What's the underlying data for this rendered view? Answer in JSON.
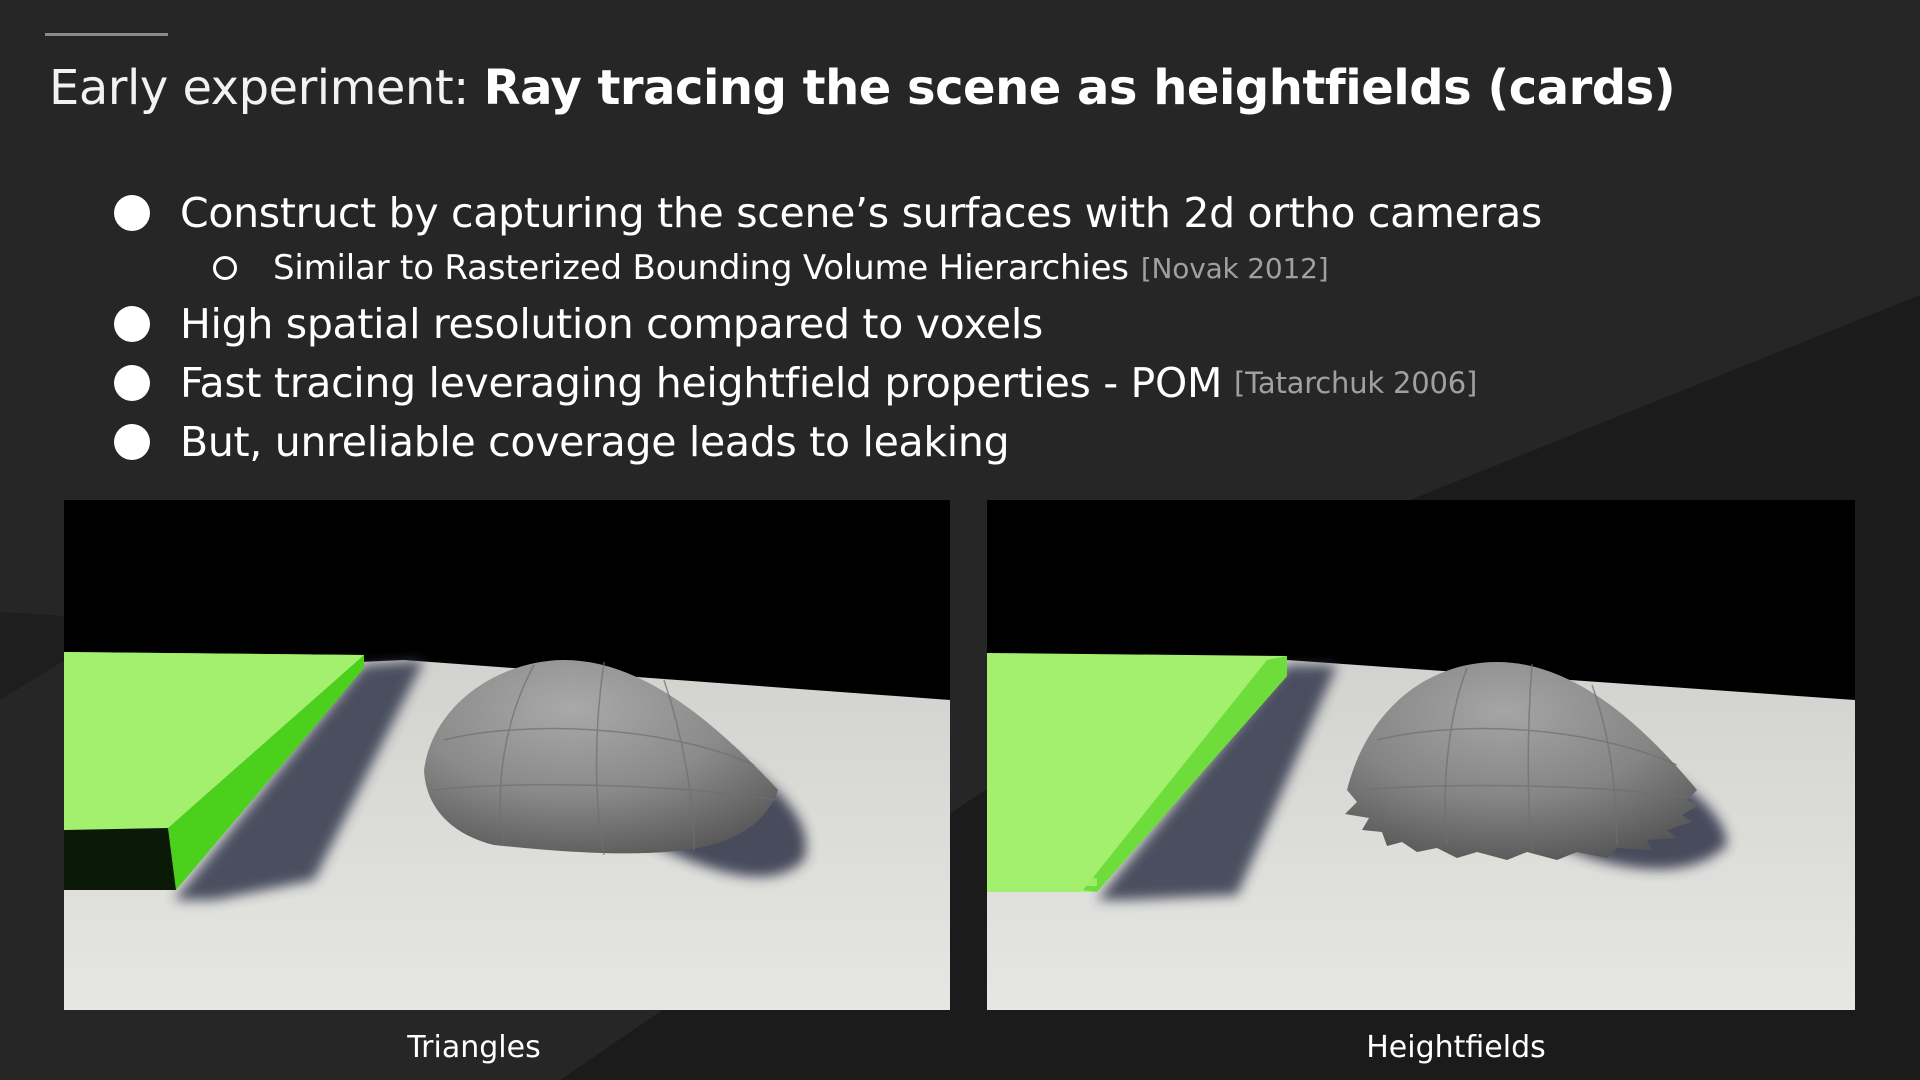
{
  "title": {
    "prefix": "Early experiment: ",
    "emphasis": "Ray tracing the scene as heightfields (cards)"
  },
  "bullets": [
    {
      "text": "Construct by capturing the scene’s surfaces with 2d ortho cameras",
      "cite": ""
    },
    {
      "text": "High spatial resolution compared to voxels",
      "cite": ""
    },
    {
      "text": "Fast tracing leveraging heightfield properties - POM",
      "cite": "[Tatarchuk 2006]"
    },
    {
      "text": "But, unreliable coverage leads to leaking",
      "cite": ""
    }
  ],
  "subbullet": {
    "text": "Similar to Rasterized Bounding Volume Hierarchies",
    "cite": "[Novak 2012]"
  },
  "figures": [
    {
      "caption": "Triangles"
    },
    {
      "caption": "Heightfields"
    }
  ],
  "colors": {
    "background": "#262626",
    "background_shape": "#1b1b1b",
    "box_green": "#a3ef6e",
    "box_side_green": "#4bd01b",
    "floor": "#dcdcd8",
    "dome": "#8f8f8f",
    "citation": "#a0a0a0"
  }
}
